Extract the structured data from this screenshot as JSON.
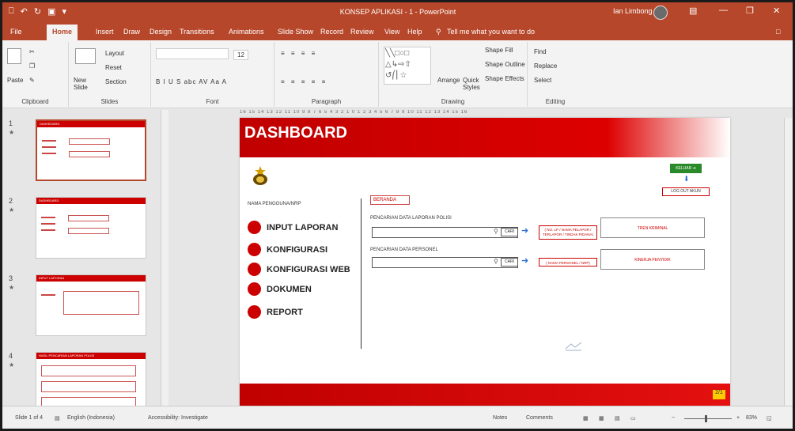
{
  "window": {
    "title": "KONSEP APLIKASI - 1 - PowerPoint",
    "user": "Ian Limbong",
    "tell_me": "Tell me what you want to do",
    "qat": [
      "⎕",
      "↶",
      "↻",
      "▣",
      "▾"
    ]
  },
  "tabs": [
    "File",
    "Home",
    "Insert",
    "Draw",
    "Design",
    "Transitions",
    "Animations",
    "Slide Show",
    "Record",
    "Review",
    "View",
    "Help"
  ],
  "ribbon": {
    "clipboard": {
      "label": "Clipboard",
      "paste": "Paste"
    },
    "slides": {
      "label": "Slides",
      "new_slide": "New Slide",
      "layout": "Layout",
      "reset": "Reset",
      "section": "Section"
    },
    "font": {
      "label": "Font",
      "size": "12",
      "format_row": "B  I  U  S  abc  AV  Aa  A"
    },
    "paragraph": {
      "label": "Paragraph"
    },
    "drawing": {
      "label": "Drawing",
      "arrange": "Arrange",
      "quick_styles": "Quick Styles",
      "shape_fill": "Shape Fill",
      "shape_outline": "Shape Outline",
      "shape_effects": "Shape Effects"
    },
    "editing": {
      "label": "Editing",
      "find": "Find",
      "replace": "Replace",
      "select": "Select"
    }
  },
  "ruler_text": "16 15 14 13 12 11 10 9 8 7 6 5 4 3 2 1 0 1 2 3 4 5 6 7 8 9 10 11 12 13 14 15 16",
  "thumbnails": [
    {
      "num": "1",
      "title": "DASHBOARD"
    },
    {
      "num": "2",
      "title": "DASHBOARD"
    },
    {
      "num": "3",
      "title": "INPUT LAPORAN"
    },
    {
      "num": "4",
      "title": "HASIL PENCARIAN LAPORAN POLISI"
    }
  ],
  "slide": {
    "title": "DASHBOARD",
    "nama_pengguna": "NAMA PENGGUNA/NRP",
    "menu": [
      "INPUT LAPORAN",
      "KONFIGURASI",
      "KONFIGURASI WEB",
      "DOKUMEN",
      "REPORT"
    ],
    "beranda": "BERANDA",
    "search1_label": "PENCARIAN DATA LAPORAN POLISI",
    "search2_label": "PENCARIAN DATA PERSONEL",
    "cari": "CARI",
    "note1": "( NO. LP / NAMA PELAPOR / TERLAPOR / TINDAK PIDANA)",
    "note2": "( NAMA PERSONEL / NRP)",
    "result1": "TREN KRIMINAL",
    "result2": "KINERJA PENYIDIK",
    "keluar": "KELUAR",
    "logout": "LOG OUT AKUN",
    "page_num": "2/1"
  },
  "status": {
    "slide": "Slide 1 of 4",
    "language": "English (Indonesia)",
    "accessibility": "Accessibility: Investigate",
    "notes": "Notes",
    "comments": "Comments",
    "zoom": "83%"
  },
  "colors": {
    "accent": "#b7472a",
    "slide_red": "#c00000"
  }
}
